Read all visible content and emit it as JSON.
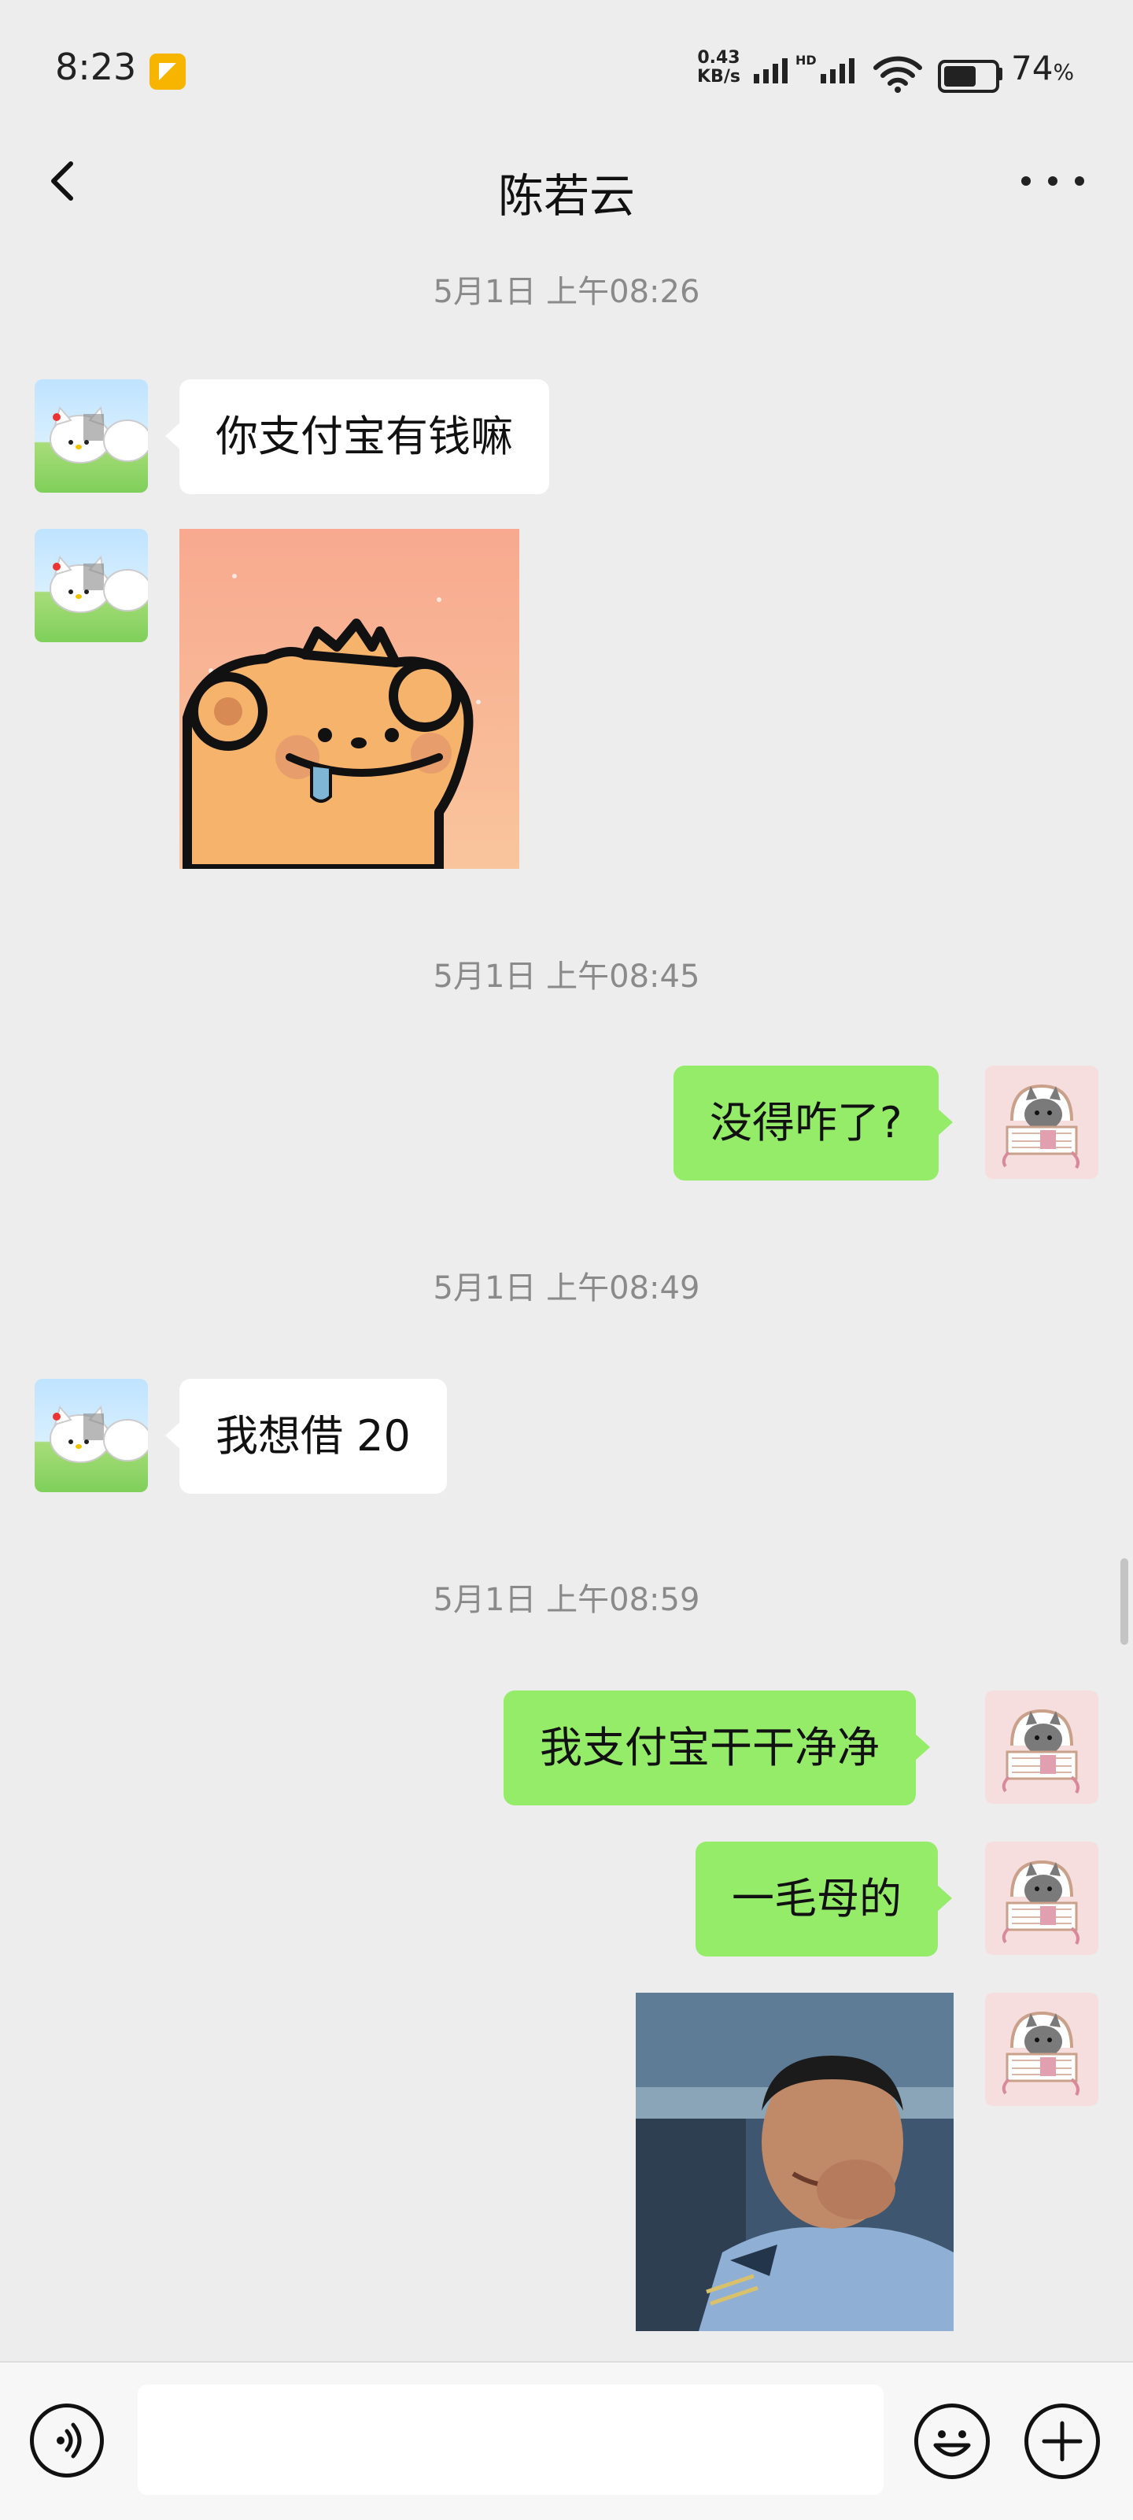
{
  "status_bar": {
    "time": "8:23",
    "net_speed_value": "0.43",
    "net_speed_unit": "KB/s",
    "hd_label": "HD",
    "battery_percent": "74",
    "battery_percent_sign": "%",
    "battery_level": 0.74
  },
  "header": {
    "title": "陈若云",
    "back_icon": "chevron-left-icon",
    "more_icon": "more-dots-icon"
  },
  "messages": [
    {
      "type": "timestamp",
      "text": "5月1日 上午08:26"
    },
    {
      "type": "text",
      "from": "contact",
      "text": "你支付宝有钱嘛"
    },
    {
      "type": "sticker",
      "from": "contact",
      "sticker": "bear-drooling-sticker"
    },
    {
      "type": "timestamp",
      "text": "5月1日 上午08:45"
    },
    {
      "type": "text",
      "from": "me",
      "text": "没得咋了?"
    },
    {
      "type": "timestamp",
      "text": "5月1日 上午08:49"
    },
    {
      "type": "text",
      "from": "contact",
      "text": "我想借 20"
    },
    {
      "type": "timestamp",
      "text": "5月1日 上午08:59"
    },
    {
      "type": "text",
      "from": "me",
      "text": "我支付宝干干净净"
    },
    {
      "type": "text",
      "from": "me",
      "text": "一毛母的"
    },
    {
      "type": "sticker",
      "from": "me",
      "sticker": "laughing-officer-meme"
    }
  ],
  "avatars": {
    "contact": "hello-kitty-avatar",
    "me": "cat-in-basket-avatar"
  },
  "input_bar": {
    "voice_icon": "voice-icon",
    "input_value": "",
    "emoji_icon": "emoji-icon",
    "plus_icon": "plus-icon"
  },
  "colors": {
    "background": "#ededed",
    "incoming_bubble": "#ffffff",
    "outgoing_bubble": "#95ec69",
    "timestamp_text": "#8a8a8a"
  }
}
